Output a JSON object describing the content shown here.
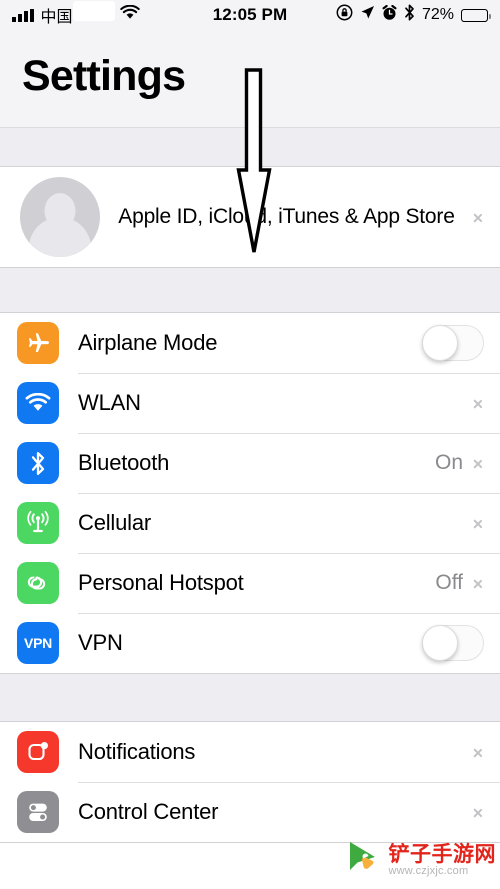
{
  "status_bar": {
    "carrier": "中国",
    "signal_icon": "signal-bars-icon",
    "wifi_icon": "wifi-icon",
    "time": "12:05 PM",
    "rotation_lock_icon": "rotation-lock-icon",
    "location_icon": "location-arrow-icon",
    "alarm_icon": "alarm-clock-icon",
    "bluetooth_icon": "bluetooth-icon",
    "battery_percent": "72%",
    "battery_icon": "battery-icon"
  },
  "nav": {
    "title": "Settings"
  },
  "apple_id": {
    "label": "Apple ID, iCloud, iTunes & App Store",
    "avatar_icon": "avatar-placeholder-icon",
    "chevron_icon": "chevron-right-icon"
  },
  "annotation": {
    "arrow_icon": "down-arrow-annotation",
    "color": "#000000"
  },
  "groups": [
    {
      "name": "connectivity",
      "rows": [
        {
          "label": "Airplane Mode",
          "icon": "airplane-icon",
          "icon_color": "#f79824",
          "accessory": "toggle",
          "toggle_on": false
        },
        {
          "label": "WLAN",
          "icon": "wifi-icon",
          "icon_color": "#1079f2",
          "accessory": "chevron",
          "value": ""
        },
        {
          "label": "Bluetooth",
          "icon": "bluetooth-icon",
          "icon_color": "#1079f2",
          "accessory": "chevron",
          "value": "On"
        },
        {
          "label": "Cellular",
          "icon": "cellular-antenna-icon",
          "icon_color": "#4cd662",
          "accessory": "chevron",
          "value": ""
        },
        {
          "label": "Personal Hotspot",
          "icon": "hotspot-link-icon",
          "icon_color": "#4cd662",
          "accessory": "chevron",
          "value": "Off"
        },
        {
          "label": "VPN",
          "icon": "vpn-icon",
          "icon_color": "#1079f2",
          "accessory": "toggle",
          "toggle_on": false,
          "icon_text": "VPN"
        }
      ]
    },
    {
      "name": "system",
      "rows": [
        {
          "label": "Notifications",
          "icon": "notifications-icon",
          "icon_color": "#f6372b",
          "accessory": "chevron",
          "value": ""
        },
        {
          "label": "Control Center",
          "icon": "control-center-icon",
          "icon_color": "#8e8e93",
          "accessory": "chevron",
          "value": ""
        }
      ]
    }
  ],
  "watermark": {
    "site_name": "铲子手游网",
    "url": "www.czjxjc.com",
    "logo_icon": "cursor-logo-icon"
  }
}
